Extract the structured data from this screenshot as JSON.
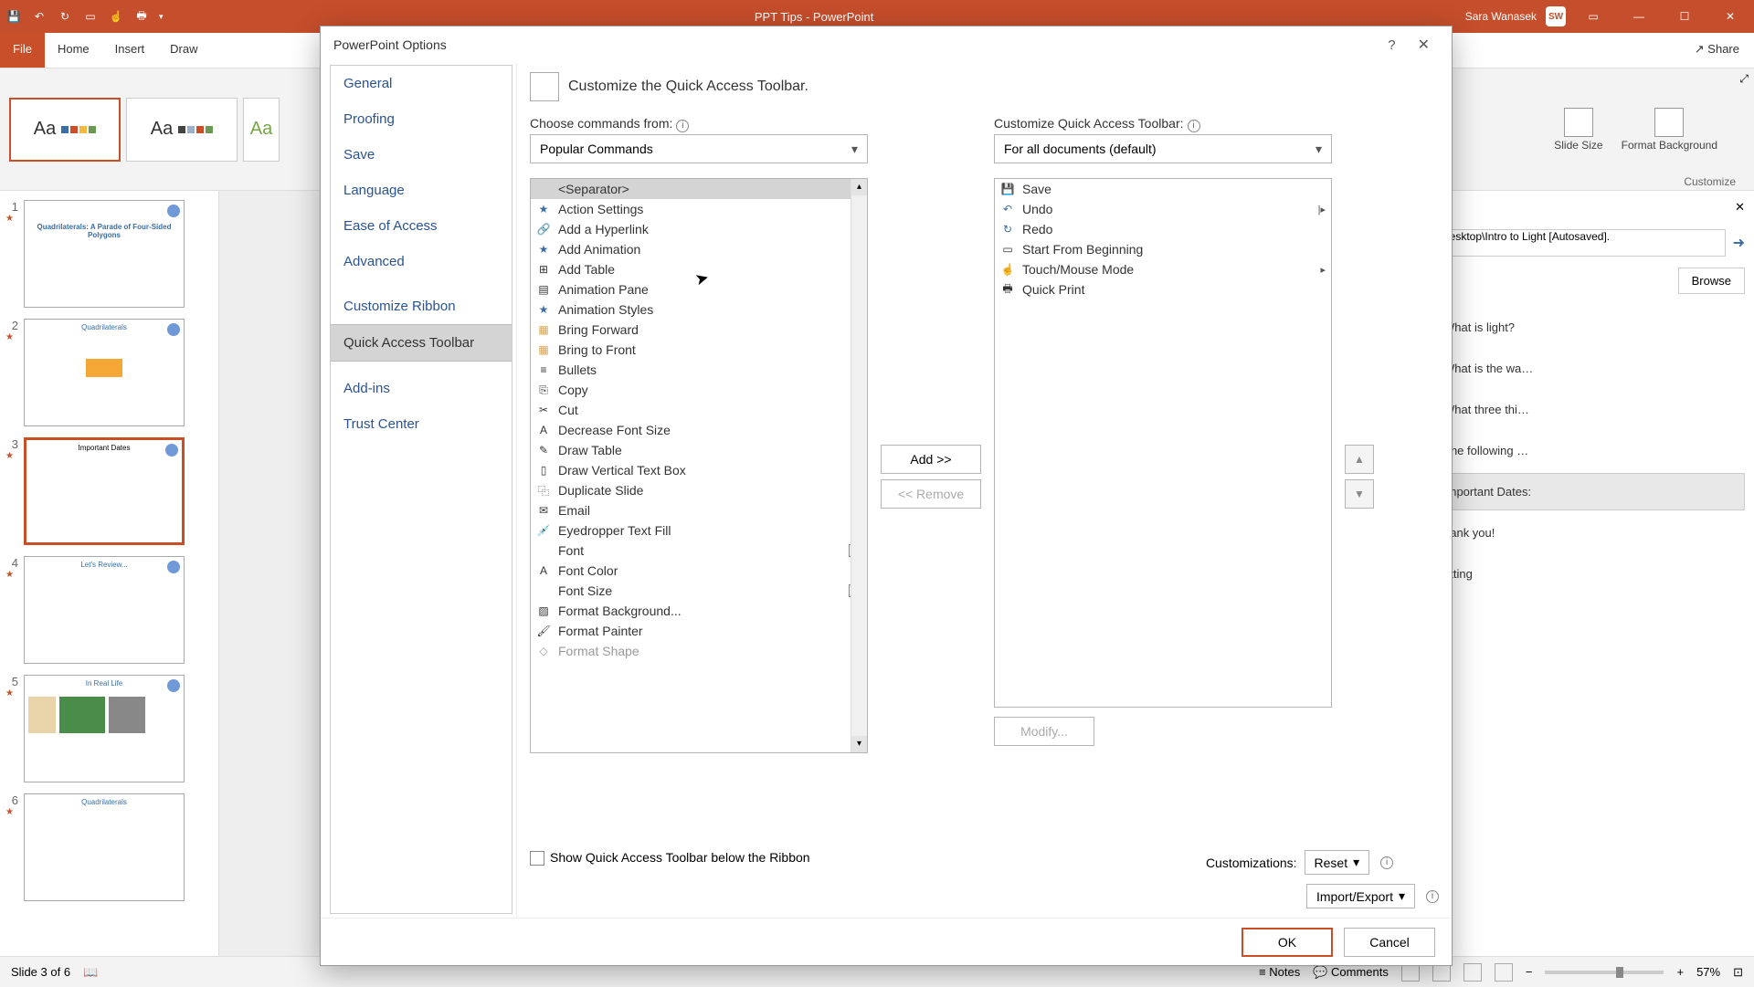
{
  "titlebar": {
    "doc_title": "PPT Tips - PowerPoint",
    "user_name": "Sara Wanasek",
    "user_initials": "SW"
  },
  "ribbon": {
    "share": "Share",
    "tabs": {
      "file": "File",
      "home": "Home",
      "insert": "Insert",
      "draw": "Draw"
    },
    "slide_size": "Slide Size",
    "format_bg": "Format Background",
    "group_customize": "Customize",
    "theme_aa": "Aa"
  },
  "slides": {
    "n1": "1",
    "n2": "2",
    "n3": "3",
    "n4": "4",
    "n5": "5",
    "n6": "6",
    "t1": "Quadrilaterals:\nA Parade of Four-Sided Polygons",
    "t2": "Quadrilaterals",
    "t3": "Important Dates",
    "t4": "Let's Review...",
    "t5": "In Real Life",
    "t6": "Quadrilaterals"
  },
  "right_panel": {
    "path_text": "Desktop\\Intro to Light [Autosaved].",
    "browse": "Browse",
    "items": {
      "i1": "What is light?",
      "i2": "What is the wa…",
      "i3": "What three thi…",
      "i4": "The following …",
      "i5": "Important Dates:",
      "i6": "hank you!",
      "i7": "atting"
    }
  },
  "status": {
    "slide_count": "Slide 3 of 6",
    "notes": "Notes",
    "comments": "Comments",
    "zoom": "57%"
  },
  "dialog": {
    "title": "PowerPoint Options",
    "head_title": "Customize the Quick Access Toolbar.",
    "sidebar": {
      "general": "General",
      "proofing": "Proofing",
      "save": "Save",
      "language": "Language",
      "ease": "Ease of Access",
      "advanced": "Advanced",
      "custom_ribbon": "Customize Ribbon",
      "qat": "Quick Access Toolbar",
      "addins": "Add-ins",
      "trust": "Trust Center"
    },
    "left_label": "Choose commands from:",
    "left_dropdown": "Popular Commands",
    "right_label": "Customize Quick Access Toolbar:",
    "right_dropdown": "For all documents (default)",
    "commands": {
      "separator": "<Separator>",
      "c1": "Action Settings",
      "c2": "Add a Hyperlink",
      "c3": "Add Animation",
      "c4": "Add Table",
      "c5": "Animation Pane",
      "c6": "Animation Styles",
      "c7": "Bring Forward",
      "c8": "Bring to Front",
      "c9": "Bullets",
      "c10": "Copy",
      "c11": "Cut",
      "c12": "Decrease Font Size",
      "c13": "Draw Table",
      "c14": "Draw Vertical Text Box",
      "c15": "Duplicate Slide",
      "c16": "Email",
      "c17": "Eyedropper Text Fill",
      "c18": "Font",
      "c19": "Font Color",
      "c20": "Font Size",
      "c21": "Format Background...",
      "c22": "Format Painter",
      "c23": "Format Shape"
    },
    "current": {
      "r1": "Save",
      "r2": "Undo",
      "r3": "Redo",
      "r4": "Start From Beginning",
      "r5": "Touch/Mouse Mode",
      "r6": "Quick Print"
    },
    "add_btn": "Add >>",
    "remove_btn": "<< Remove",
    "modify_btn": "Modify...",
    "show_below": "Show Quick Access Toolbar below the Ribbon",
    "customizations": "Customizations:",
    "reset": "Reset",
    "import_export": "Import/Export",
    "ok": "OK",
    "cancel": "Cancel"
  }
}
